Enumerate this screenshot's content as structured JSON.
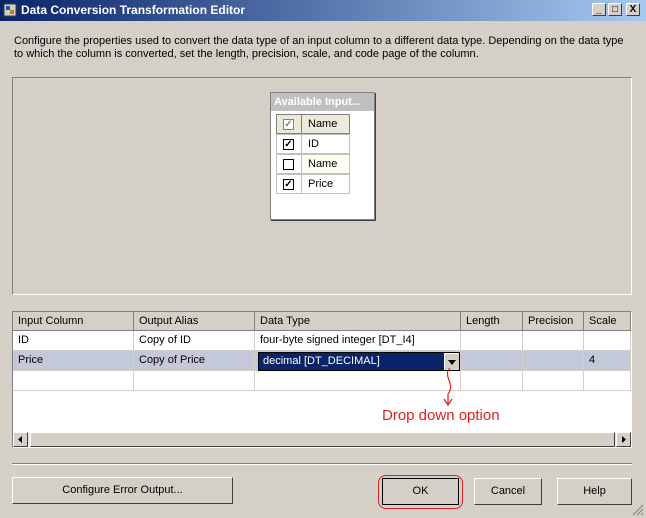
{
  "window": {
    "title": "Data Conversion Transformation Editor",
    "minimize": "_",
    "maximize": "□",
    "close": "X",
    "icon": "ssis-component-icon"
  },
  "description": "Configure the properties used to convert the data type of an input column to a different data type. Depending on the data type to which the column is converted, set the length, precision, scale, and code page of the column.",
  "available_inputs": {
    "title": "Available Input...",
    "header": "Name",
    "rows": [
      {
        "name": "ID",
        "checked": true
      },
      {
        "name": "Name",
        "checked": false
      },
      {
        "name": "Price",
        "checked": true
      }
    ]
  },
  "grid": {
    "columns": [
      "Input Column",
      "Output Alias",
      "Data Type",
      "Length",
      "Precision",
      "Scale"
    ],
    "rows": [
      {
        "input": "ID",
        "alias": "Copy of ID",
        "type": "four-byte signed integer [DT_I4]",
        "length": "",
        "precision": "",
        "scale": ""
      },
      {
        "input": "Price",
        "alias": "Copy of Price",
        "type": "decimal [DT_DECIMAL]",
        "length": "",
        "precision": "",
        "scale": "4"
      }
    ]
  },
  "annotation": "Drop down option",
  "buttons": {
    "configure_error_output": "Configure Error Output...",
    "ok": "OK",
    "cancel": "Cancel",
    "help": "Help"
  },
  "colors": {
    "titlebar": "#0a246a",
    "selection": "#0a246a",
    "annotation": "#e02020"
  }
}
